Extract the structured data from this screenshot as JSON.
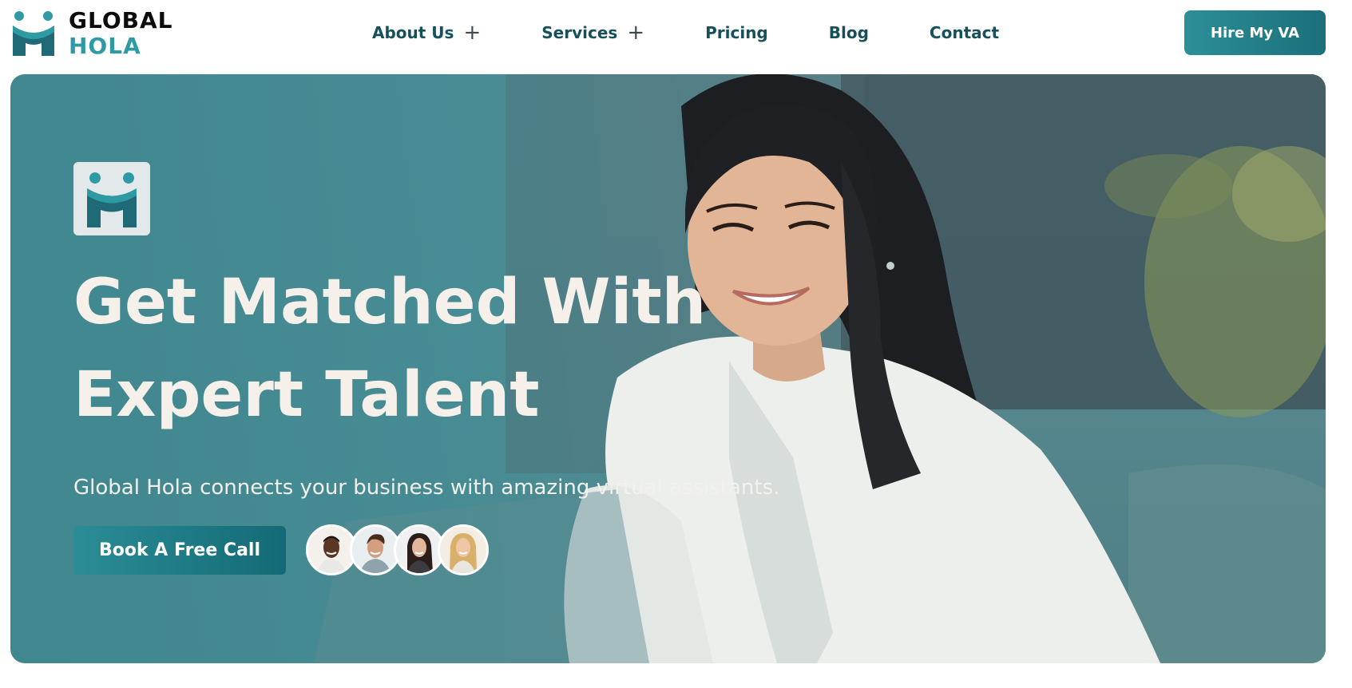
{
  "brand": {
    "name_line1": "GLOBAL",
    "name_line2": "HOLA",
    "colors": {
      "teal": "#2e9aa3",
      "dark_teal": "#16505a",
      "cream": "#f5f0ea"
    }
  },
  "nav": {
    "items": [
      {
        "label": "About Us",
        "has_submenu": true
      },
      {
        "label": "Services",
        "has_submenu": true
      },
      {
        "label": "Pricing",
        "has_submenu": false
      },
      {
        "label": "Blog",
        "has_submenu": false
      },
      {
        "label": "Contact",
        "has_submenu": false
      }
    ],
    "submenu_glyph": "+",
    "cta_label": "Hire My VA"
  },
  "hero": {
    "title_line1": "Get Matched With",
    "title_line2": "Expert Talent",
    "subtitle": "Global Hola connects your business with amazing virtual assistants.",
    "cta_label": "Book A Free Call",
    "avatars": [
      "avatar-man-dark-hair",
      "avatar-man-brown-hair",
      "avatar-woman-dark-hair",
      "avatar-woman-blonde"
    ],
    "image": "woman-smiling-at-laptop"
  }
}
